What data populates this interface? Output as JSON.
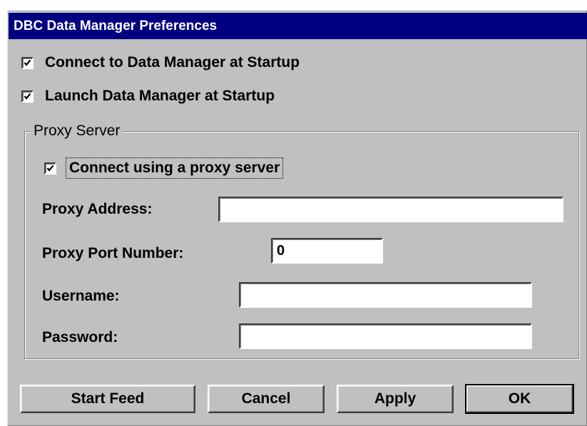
{
  "window": {
    "title": "DBC Data Manager Preferences"
  },
  "options": {
    "connect_at_startup": {
      "label": "Connect to Data Manager at Startup",
      "checked": true
    },
    "launch_at_startup": {
      "label": "Launch Data Manager at Startup",
      "checked": true
    }
  },
  "proxy": {
    "group_label": "Proxy Server",
    "use_proxy": {
      "label": "Connect using a proxy server",
      "checked": true
    },
    "address": {
      "label": "Proxy Address:",
      "value": ""
    },
    "port": {
      "label": "Proxy Port Number:",
      "value": "0"
    },
    "username": {
      "label": "Username:",
      "value": ""
    },
    "password": {
      "label": "Password:",
      "value": ""
    }
  },
  "buttons": {
    "start_feed": "Start Feed",
    "cancel": "Cancel",
    "apply": "Apply",
    "ok": "OK"
  },
  "colors": {
    "dialog_face": "#c0c0c0",
    "title_bar": "#000080",
    "title_text": "#ffffff"
  }
}
